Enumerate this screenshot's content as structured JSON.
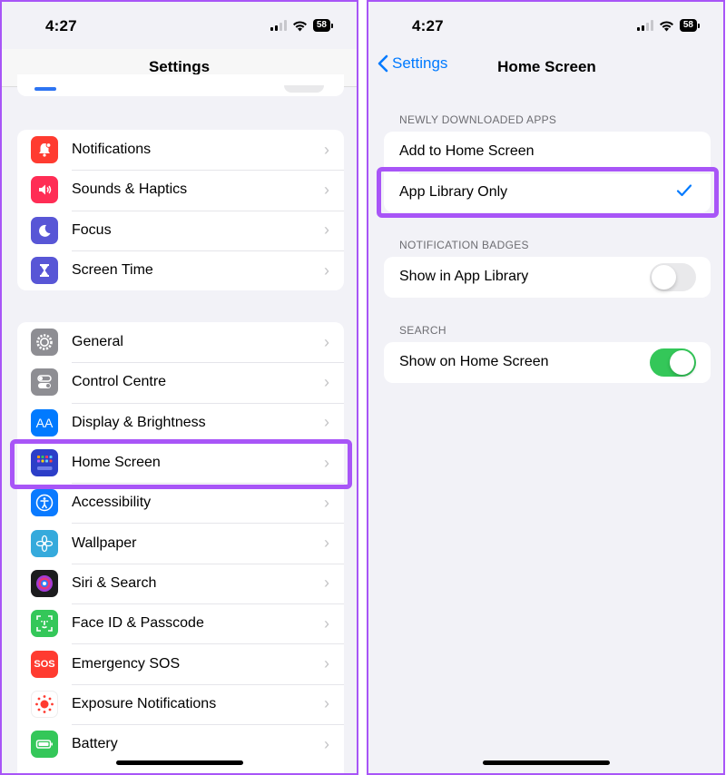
{
  "status": {
    "time": "4:27",
    "battery": "58"
  },
  "left": {
    "title": "Settings",
    "group1": [
      {
        "label": "Notifications",
        "icon": "bell-icon",
        "color": "#ff3b30"
      },
      {
        "label": "Sounds & Haptics",
        "icon": "speaker-icon",
        "color": "#ff2d55"
      },
      {
        "label": "Focus",
        "icon": "moon-icon",
        "color": "#5856d6"
      },
      {
        "label": "Screen Time",
        "icon": "hourglass-icon",
        "color": "#5856d6"
      }
    ],
    "group2": [
      {
        "label": "General",
        "icon": "gear-icon",
        "color": "#8e8e93"
      },
      {
        "label": "Control Centre",
        "icon": "toggles-icon",
        "color": "#8e8e93"
      },
      {
        "label": "Display & Brightness",
        "icon": "text-size-icon",
        "color": "#007aff",
        "glyph": "AA"
      },
      {
        "label": "Home Screen",
        "icon": "home-grid-icon",
        "color": "#2c3ec8"
      },
      {
        "label": "Accessibility",
        "icon": "accessibility-icon",
        "color": "#0a7aff"
      },
      {
        "label": "Wallpaper",
        "icon": "flower-icon",
        "color": "#35aadc"
      },
      {
        "label": "Siri & Search",
        "icon": "siri-icon",
        "color": "#1c1c1e"
      },
      {
        "label": "Face ID & Passcode",
        "icon": "face-id-icon",
        "color": "#34c759"
      },
      {
        "label": "Emergency SOS",
        "icon": "sos-icon",
        "color": "#ff3b30",
        "glyph": "SOS"
      },
      {
        "label": "Exposure Notifications",
        "icon": "exposure-icon",
        "color": "#ffffff"
      },
      {
        "label": "Battery",
        "icon": "battery-icon",
        "color": "#34c759"
      }
    ]
  },
  "right": {
    "back_label": "Settings",
    "title": "Home Screen",
    "sections": {
      "downloads_header": "NEWLY DOWNLOADED APPS",
      "badges_header": "NOTIFICATION BADGES",
      "search_header": "SEARCH"
    },
    "downloads": [
      {
        "label": "Add to Home Screen",
        "selected": false
      },
      {
        "label": "App Library Only",
        "selected": true
      }
    ],
    "badges_row": {
      "label": "Show in App Library",
      "on": false
    },
    "search_row": {
      "label": "Show on Home Screen",
      "on": true
    }
  },
  "colors": {
    "accent": "#007aff",
    "highlight": "#a855f7",
    "toggle_on": "#34c759"
  }
}
